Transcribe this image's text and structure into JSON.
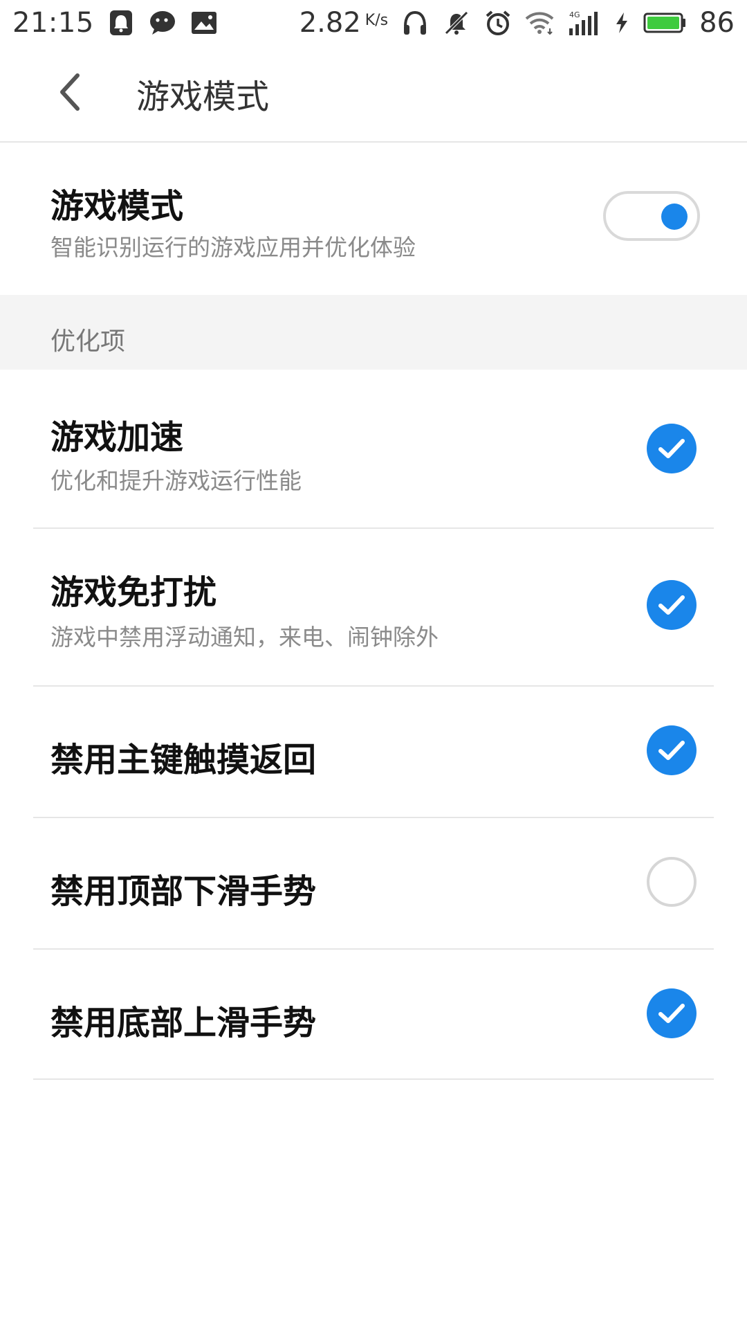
{
  "status_bar": {
    "time": "21:15",
    "net_speed": "2.82",
    "net_speed_unit": "K/s",
    "network_type": "4G",
    "battery_level": "86",
    "icons": [
      "bell-icon",
      "chat-bubble-icon",
      "image-notification-icon",
      "headphones-icon",
      "mute-icon",
      "alarm-icon",
      "wifi-icon",
      "cell-signal-icon",
      "charging-icon",
      "battery-icon"
    ]
  },
  "toolbar": {
    "title": "游戏模式",
    "back_icon": "chevron-left-icon"
  },
  "game_mode": {
    "title": "游戏模式",
    "subtitle": "智能识别运行的游戏应用并优化体验",
    "enabled": true
  },
  "section": {
    "label": "优化项"
  },
  "items": [
    {
      "title": "游戏加速",
      "subtitle": "优化和提升游戏运行性能",
      "checked": true
    },
    {
      "title": "游戏免打扰",
      "subtitle": "游戏中禁用浮动通知，来电、闹钟除外",
      "checked": true
    },
    {
      "title": "禁用主键触摸返回",
      "checked": true
    },
    {
      "title": "禁用顶部下滑手势",
      "checked": false
    },
    {
      "title": "禁用底部上滑手势",
      "checked": true
    }
  ],
  "colors": {
    "accent": "#1a86ea",
    "battery": "#3ecb3e"
  }
}
